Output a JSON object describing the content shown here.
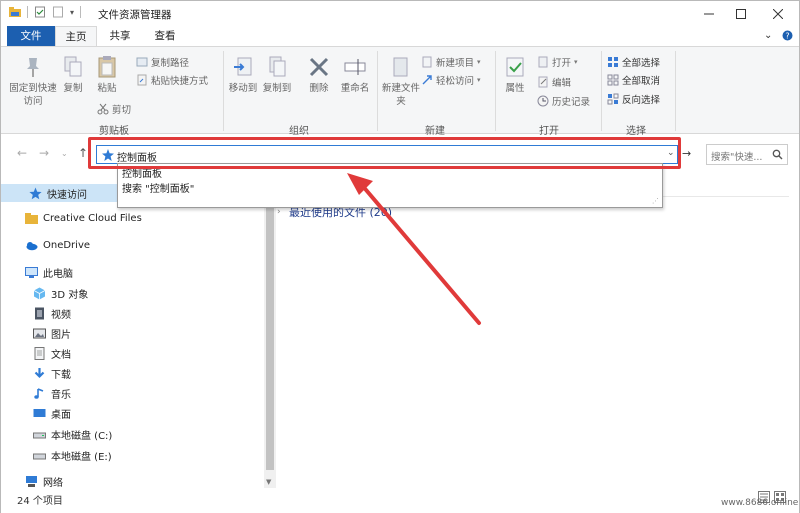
{
  "window": {
    "title": "文件资源管理器"
  },
  "ribbon_tabs": [
    "文件",
    "主页",
    "共享",
    "查看"
  ],
  "clipboard": {
    "pin_label": "固定到快速访问",
    "copy_label": "复制",
    "paste_label": "粘贴",
    "copy_path_label": "复制路径",
    "paste_shortcut_label": "粘贴快捷方式",
    "cut_label": "剪切",
    "group_label": "剪贴板"
  },
  "organize": {
    "move_to_label": "移动到",
    "copy_to_label": "复制到",
    "delete_label": "删除",
    "rename_label": "重命名",
    "group_label": "组织"
  },
  "new_group": {
    "new_folder_label": "新建文件夹",
    "new_item_label": "新建项目",
    "easy_access_label": "轻松访问",
    "group_label": "新建"
  },
  "open_group": {
    "properties_label": "属性",
    "open_label": "打开",
    "edit_label": "编辑",
    "history_label": "历史记录",
    "group_label": "打开"
  },
  "select_group": {
    "select_all_label": "全部选择",
    "select_none_label": "全部取消",
    "invert_label": "反向选择",
    "group_label": "选择"
  },
  "address": {
    "value": "控制面板",
    "search_placeholder": "搜索\"快速..."
  },
  "suggestions": [
    "控制面板",
    "搜索 \"控制面板\""
  ],
  "nav_pane": {
    "quick_access": "快速访问",
    "creative_cloud": "Creative Cloud Files",
    "onedrive": "OneDrive",
    "this_pc": "此电脑",
    "objects_3d": "3D 对象",
    "videos": "视频",
    "pictures": "图片",
    "documents": "文档",
    "downloads": "下载",
    "music": "音乐",
    "desktop": "桌面",
    "disk_c": "本地磁盘 (C:)",
    "disk_e": "本地磁盘 (E:)",
    "network": "网络"
  },
  "content": {
    "recent_files": "最近使用的文件 (20)"
  },
  "status": {
    "item_count": "24 个项目"
  },
  "watermark": "www.8686.online",
  "colors": {
    "accent": "#1c5fb0",
    "highlight": "#e03a3a"
  }
}
